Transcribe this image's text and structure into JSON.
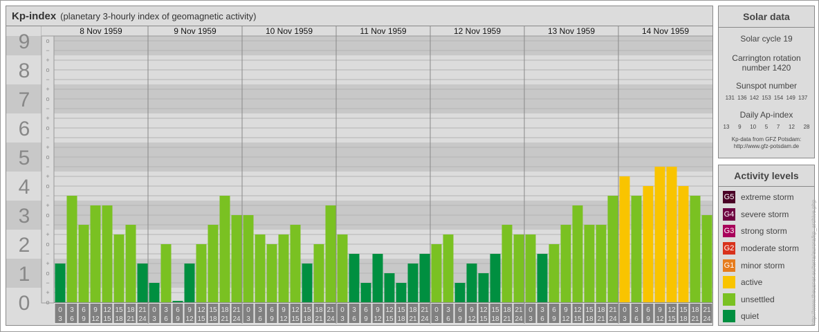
{
  "header": {
    "title": "Kp-index",
    "subtitle": "(planetary 3-hourly index of geomagnetic activity)"
  },
  "chart_data": {
    "type": "bar",
    "title": "Kp-index",
    "ylabel": "Kp",
    "ylim": [
      0,
      9
    ],
    "y_ticks": [
      "0",
      "1",
      "2",
      "3",
      "4",
      "5",
      "6",
      "7",
      "8",
      "9"
    ],
    "days": [
      "8 Nov 1959",
      "9 Nov 1959",
      "10 Nov 1959",
      "11 Nov 1959",
      "12 Nov 1959",
      "13 Nov 1959",
      "14 Nov 1959"
    ],
    "hour_intervals": [
      [
        "0",
        "3"
      ],
      [
        "3",
        "6"
      ],
      [
        "6",
        "9"
      ],
      [
        "9",
        "12"
      ],
      [
        "12",
        "15"
      ],
      [
        "15",
        "18"
      ],
      [
        "18",
        "21"
      ],
      [
        "21",
        "24"
      ]
    ],
    "kp": [
      [
        "1+",
        "4-",
        "3-",
        "3+",
        "3+",
        "2+",
        "3-",
        "1+"
      ],
      [
        "1-",
        "2o",
        "0o",
        "1+",
        "2o",
        "3-",
        "4-",
        "3o"
      ],
      [
        "3o",
        "2+",
        "2o",
        "2+",
        "3-",
        "1+",
        "2o",
        "3+"
      ],
      [
        "2+",
        "2-",
        "1-",
        "2-",
        "1o",
        "1-",
        "1+",
        "2-"
      ],
      [
        "2o",
        "2+",
        "1-",
        "1+",
        "1o",
        "2-",
        "3-",
        "2+"
      ],
      [
        "2+",
        "2-",
        "2o",
        "3-",
        "3+",
        "3-",
        "3-",
        "4-"
      ],
      [
        "4+",
        "4-",
        "4o",
        "5-",
        "5-",
        "4o",
        "4-",
        "3o"
      ]
    ]
  },
  "solar": {
    "title": "Solar data",
    "cycle": "Solar cycle 19",
    "carrington_1": "Carrington rotation",
    "carrington_2": "number 1420",
    "sunspot_label": "Sunspot number",
    "sunspots": "131 136 142 153 154 149 137",
    "ap_label": "Daily Ap-index",
    "ap": "13   9   10   5   7   12   28",
    "source_1": "Kp-data from  GFZ Potsdam:",
    "source_2": "http://www.gfz-potsdam.de"
  },
  "levels": {
    "title": "Activity levels",
    "items": [
      {
        "badge": "G5",
        "label": "extreme storm",
        "color": "#4a0026"
      },
      {
        "badge": "G4",
        "label": "severe storm",
        "color": "#6e0040"
      },
      {
        "badge": "G3",
        "label": "strong storm",
        "color": "#a8005a"
      },
      {
        "badge": "G2",
        "label": "moderate storm",
        "color": "#d8321c"
      },
      {
        "badge": "G1",
        "label": "minor storm",
        "color": "#e67c1e"
      },
      {
        "badge": "",
        "label": "active",
        "color": "#f9c400"
      },
      {
        "badge": "",
        "label": "unsettled",
        "color": "#7ac122"
      },
      {
        "badge": "",
        "label": "quiet",
        "color": "#008f40"
      }
    ]
  },
  "credit": "http://www.theusner.eu/terra/aurora/kp_archive.php"
}
